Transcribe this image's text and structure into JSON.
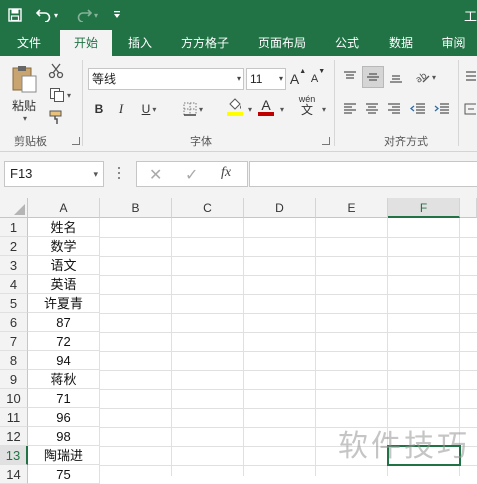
{
  "titlebar": {
    "title_fragment": "工"
  },
  "ribbon_tabs": [
    {
      "label": "文件"
    },
    {
      "label": "开始"
    },
    {
      "label": "插入"
    },
    {
      "label": "方方格子"
    },
    {
      "label": "页面布局"
    },
    {
      "label": "公式"
    },
    {
      "label": "数据"
    },
    {
      "label": "审阅"
    }
  ],
  "clipboard": {
    "paste_label": "粘贴",
    "group_label": "剪贴板"
  },
  "font": {
    "name": "等线",
    "size": "11",
    "bold": "B",
    "italic": "I",
    "underline": "U",
    "font_color_glyph": "A",
    "phonetic_label": "wén",
    "phonetic_glyph": "文",
    "group_label": "字体",
    "grow_glyph": "A",
    "shrink_glyph": "A"
  },
  "alignment": {
    "group_label": "对齐方式"
  },
  "formula_bar": {
    "name_box": "F13",
    "fx": "fx",
    "formula": ""
  },
  "columns": [
    "A",
    "B",
    "C",
    "D",
    "E",
    "F"
  ],
  "rows": [
    "1",
    "2",
    "3",
    "4",
    "5",
    "6",
    "7",
    "8",
    "9",
    "10",
    "11",
    "12",
    "13",
    "14"
  ],
  "cells_A": [
    "姓名",
    "数学",
    "语文",
    "英语",
    "许夏青",
    "87",
    "72",
    "94",
    "蒋秋",
    "71",
    "96",
    "98",
    "陶瑞进",
    "75"
  ],
  "watermark": "软件技巧",
  "colors": {
    "accent": "#217346",
    "highlight_yellow": "#ffff00",
    "font_red": "#c00000"
  }
}
